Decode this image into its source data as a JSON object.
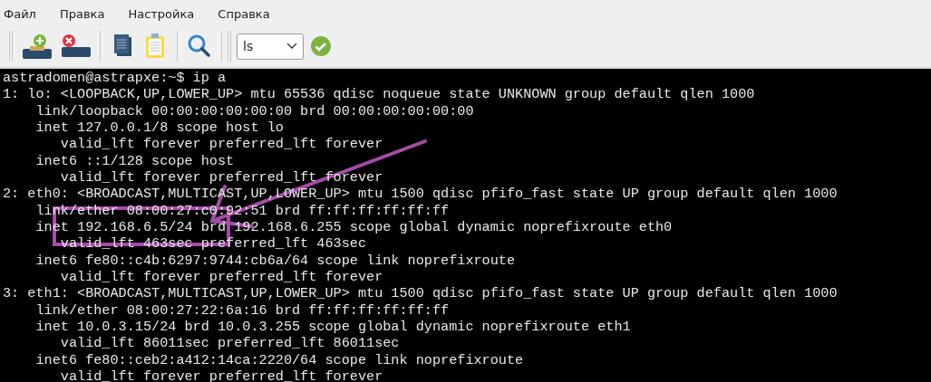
{
  "menu": [
    {
      "label": "Файл"
    },
    {
      "label": "Правка"
    },
    {
      "label": "Настройка"
    },
    {
      "label": "Справка"
    }
  ],
  "toolbar": {
    "command_select": {
      "value": "ls"
    }
  },
  "terminal": {
    "lines": [
      "astradomen@astrapxe:~$ ip a",
      "1: lo: <LOOPBACK,UP,LOWER_UP> mtu 65536 qdisc noqueue state UNKNOWN group default qlen 1000",
      "    link/loopback 00:00:00:00:00:00 brd 00:00:00:00:00:00",
      "    inet 127.0.0.1/8 scope host lo",
      "       valid_lft forever preferred_lft forever",
      "    inet6 ::1/128 scope host",
      "       valid_lft forever preferred_lft forever",
      "2: eth0: <BROADCAST,MULTICAST,UP,LOWER_UP> mtu 1500 qdisc pfifo_fast state UP group default qlen 1000",
      "    link/ether 08:00:27:c0:92:51 brd ff:ff:ff:ff:ff:ff",
      "    inet 192.168.6.5/24 brd 192.168.6.255 scope global dynamic noprefixroute eth0",
      "       valid_lft 463sec preferred_lft 463sec",
      "    inet6 fe80::c4b:6297:9744:cb6a/64 scope link noprefixroute",
      "       valid_lft forever preferred_lft forever",
      "3: eth1: <BROADCAST,MULTICAST,UP,LOWER_UP> mtu 1500 qdisc pfifo_fast state UP group default qlen 1000",
      "    link/ether 08:00:27:22:6a:16 brd ff:ff:ff:ff:ff:ff",
      "    inet 10.0.3.15/24 brd 10.0.3.255 scope global dynamic noprefixroute eth1",
      "       valid_lft 86011sec preferred_lft 86011sec",
      "    inet6 fe80::ceb2:a412:14ca:2220/64 scope link noprefixroute",
      "       valid_lft forever preferred_lft forever"
    ]
  }
}
